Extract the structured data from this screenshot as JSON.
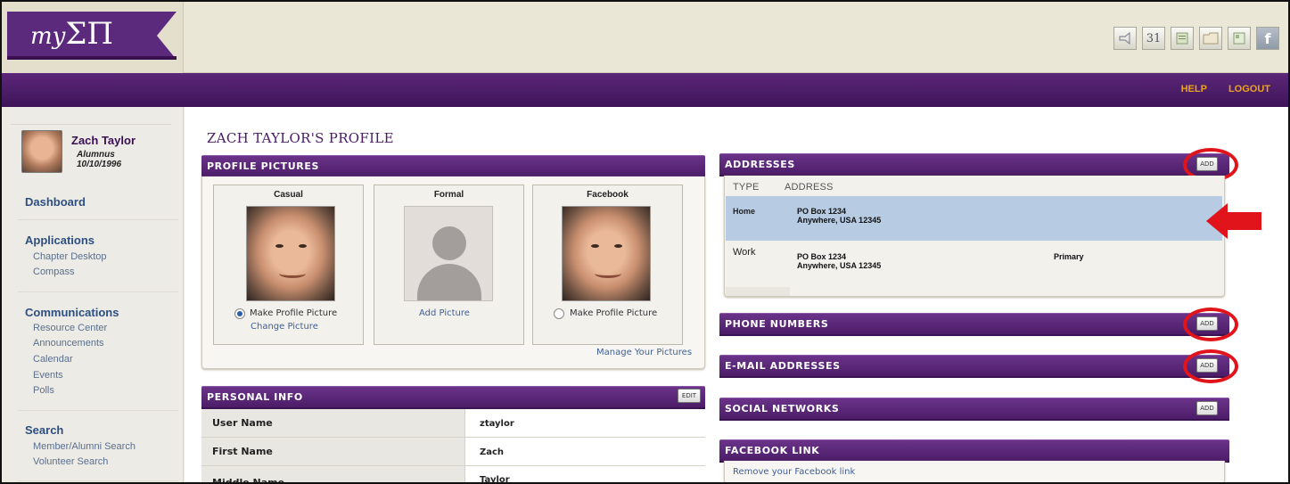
{
  "header": {
    "logo": {
      "prefix": "my",
      "letters": "ΣΠ"
    },
    "toolbar_icons": [
      "megaphone-icon",
      "calendar-icon",
      "document-icon",
      "folder-icon",
      "newsletter-icon",
      "facebook-icon"
    ],
    "calendar_day": "31",
    "facebook_glyph": "f",
    "links": {
      "help": "HELP",
      "logout": "LOGOUT"
    }
  },
  "sidebar": {
    "user": {
      "name": "Zach Taylor",
      "role": "Alumnus",
      "date": "10/10/1996"
    },
    "dashboard": "Dashboard",
    "applications": {
      "title": "Applications",
      "items": [
        "Chapter Desktop",
        "Compass"
      ]
    },
    "communications": {
      "title": "Communications",
      "items": [
        "Resource Center",
        "Announcements",
        "Calendar",
        "Events",
        "Polls"
      ]
    },
    "search": {
      "title": "Search",
      "items": [
        "Member/Alumni Search",
        "Volunteer Search"
      ]
    }
  },
  "page": {
    "title": "ZACH TAYLOR'S PROFILE"
  },
  "profile_pictures": {
    "title": "PROFILE PICTURES",
    "cards": [
      {
        "title": "Casual",
        "radio_label": "Make Profile Picture",
        "link": "Change Picture",
        "selected": true
      },
      {
        "title": "Formal",
        "link": "Add Picture"
      },
      {
        "title": "Facebook",
        "radio_label": "Make Profile Picture",
        "selected": false
      }
    ],
    "manage_link": "Manage Your Pictures"
  },
  "personal_info": {
    "title": "PERSONAL INFO",
    "edit_label": "EDIT",
    "rows": [
      {
        "label": "User Name",
        "value": "ztaylor"
      },
      {
        "label": "First Name",
        "value": "Zach"
      },
      {
        "label": "Middle Name",
        "value": "Taylor"
      }
    ]
  },
  "addresses": {
    "title": "ADDRESSES",
    "add_label": "ADD",
    "columns": [
      "TYPE",
      "ADDRESS"
    ],
    "rows": [
      {
        "type": "Home",
        "line1": "PO Box 1234",
        "line2": "Anywhere, USA 12345",
        "status": "",
        "highlighted": true
      },
      {
        "type": "Work",
        "line1": "PO Box 1234",
        "line2": "Anywhere, USA 12345",
        "status": "Primary",
        "highlighted": false
      }
    ]
  },
  "phone_numbers": {
    "title": "PHONE NUMBERS",
    "add_label": "ADD"
  },
  "email_addresses": {
    "title": "E-MAIL ADDRESSES",
    "add_label": "ADD"
  },
  "social_networks": {
    "title": "SOCIAL NETWORKS",
    "add_label": "ADD"
  },
  "facebook_link": {
    "title": "FACEBOOK LINK",
    "remove_link": "Remove your Facebook link"
  },
  "colors": {
    "brand_purple": "#4c1d68",
    "accent_gold": "#e9a320",
    "highlight_row": "#b7cbe2",
    "annotation_red": "#e0141a"
  }
}
